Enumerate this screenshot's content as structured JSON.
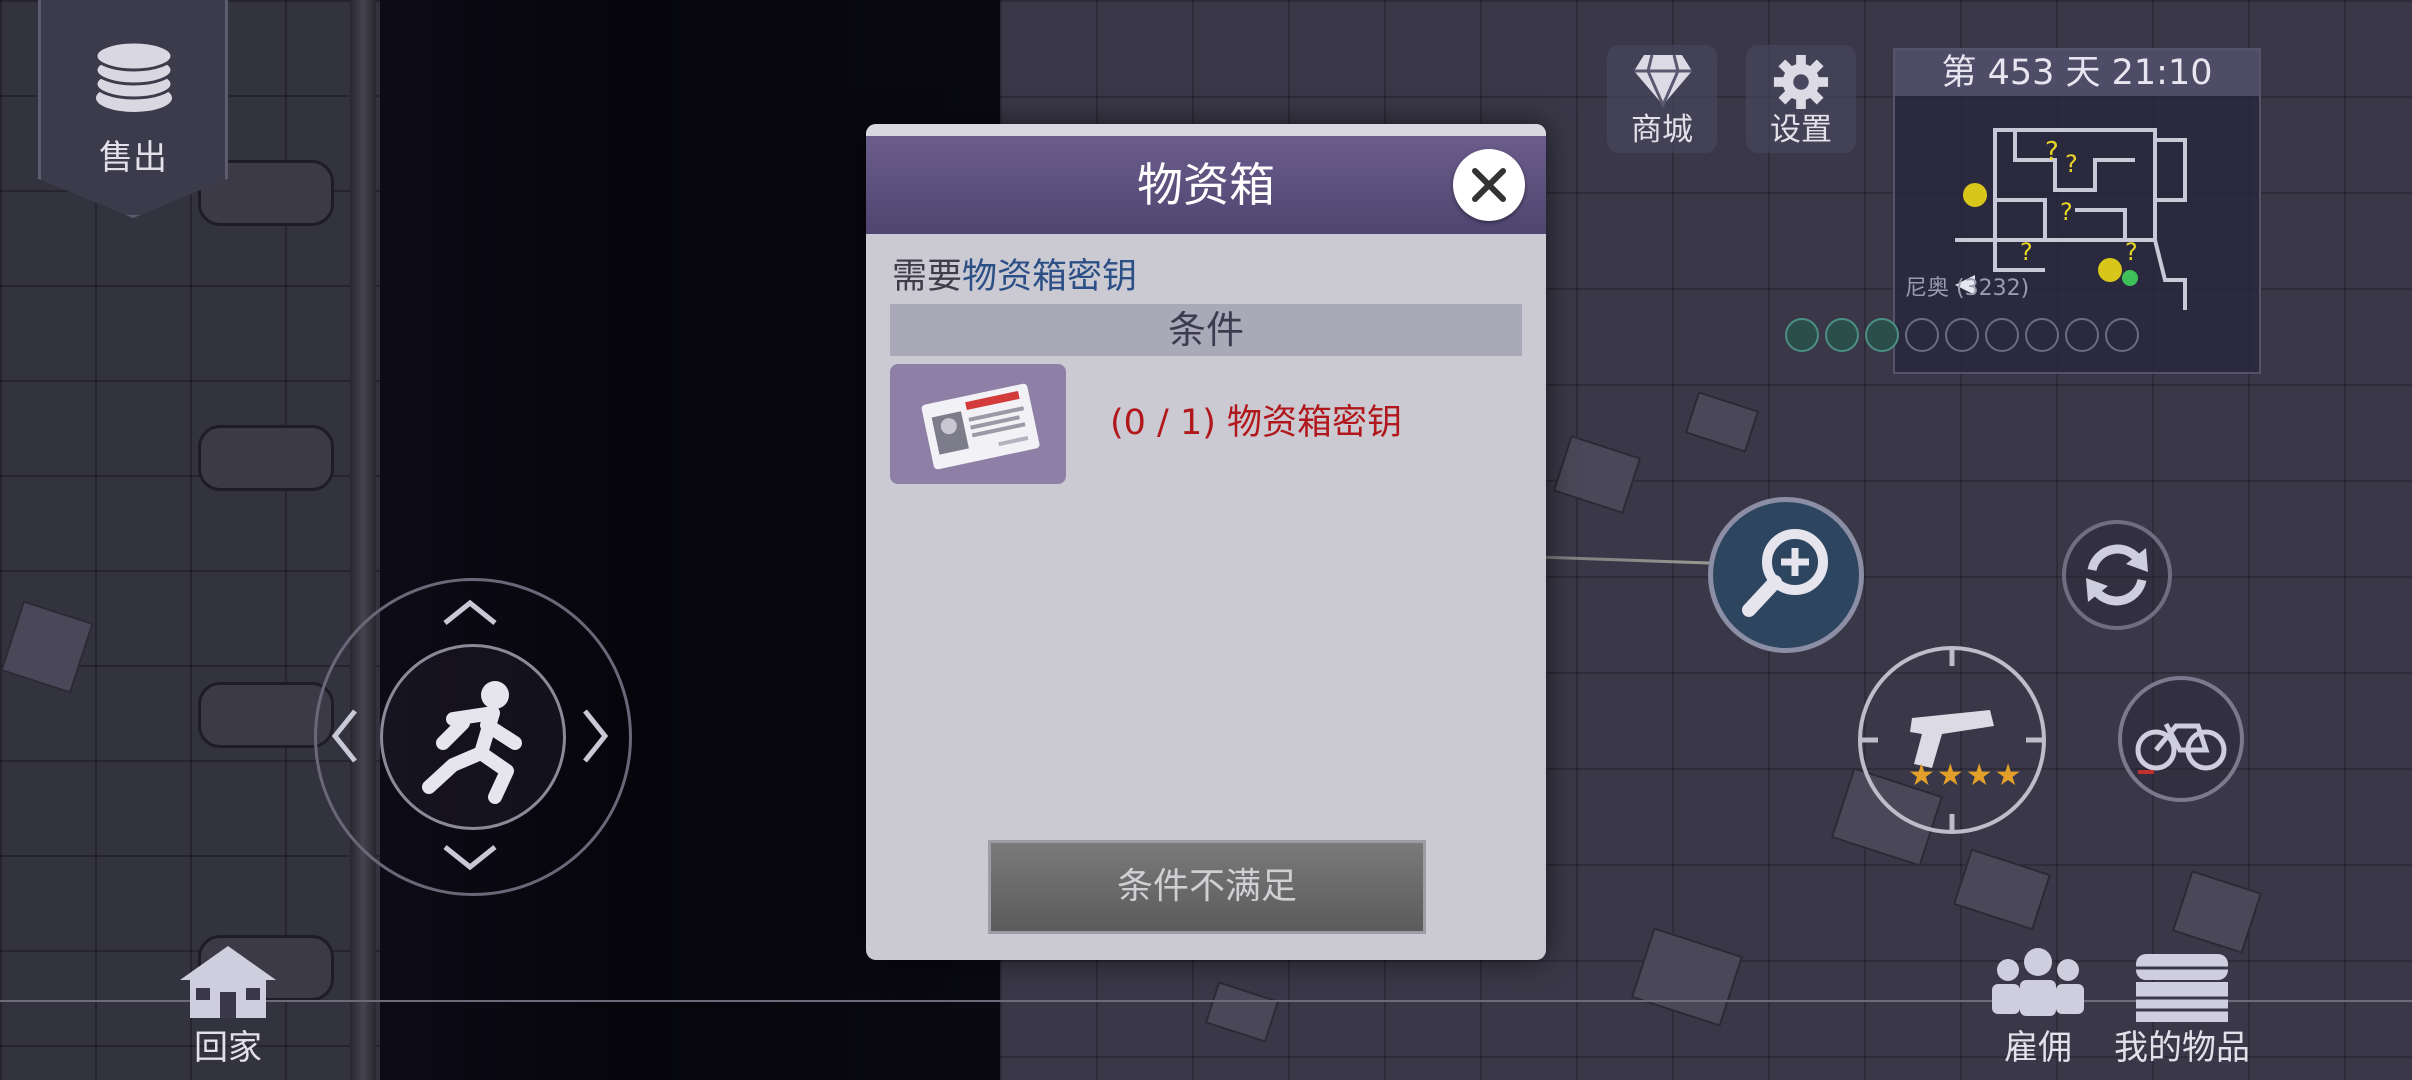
{
  "hud": {
    "sell_label": "售出",
    "shop_label": "商城",
    "settings_label": "设置",
    "day_text": "第 453 天  21:10",
    "minimap_label": "尼奥 (3232)",
    "weapon_stars": "★★★★",
    "home_label": "回家",
    "hire_label": "雇佣",
    "items_label": "我的物品"
  },
  "dialog": {
    "title": "物资箱",
    "requirement_prefix": "需要",
    "requirement_item": "物资箱密钥",
    "conditions_header": "条件",
    "condition_text": "(0 / 1) 物资箱密钥",
    "action_label": "条件不满足"
  },
  "colors": {
    "dialog_header": "#5a4e7c",
    "condition_unmet": "#b1181c",
    "requirement_highlight": "#2c4f85"
  },
  "icons": {
    "sell": "coins-icon",
    "shop": "diamond-icon",
    "settings": "gear-icon",
    "move": "running-man-icon",
    "zoom": "magnifier-plus-icon",
    "refresh": "refresh-icon",
    "weapon": "pistol-icon",
    "vehicle": "bicycle-icon",
    "home": "house-icon",
    "hire": "people-icon",
    "items": "chest-icon",
    "close": "close-icon",
    "item": "id-card-icon"
  }
}
